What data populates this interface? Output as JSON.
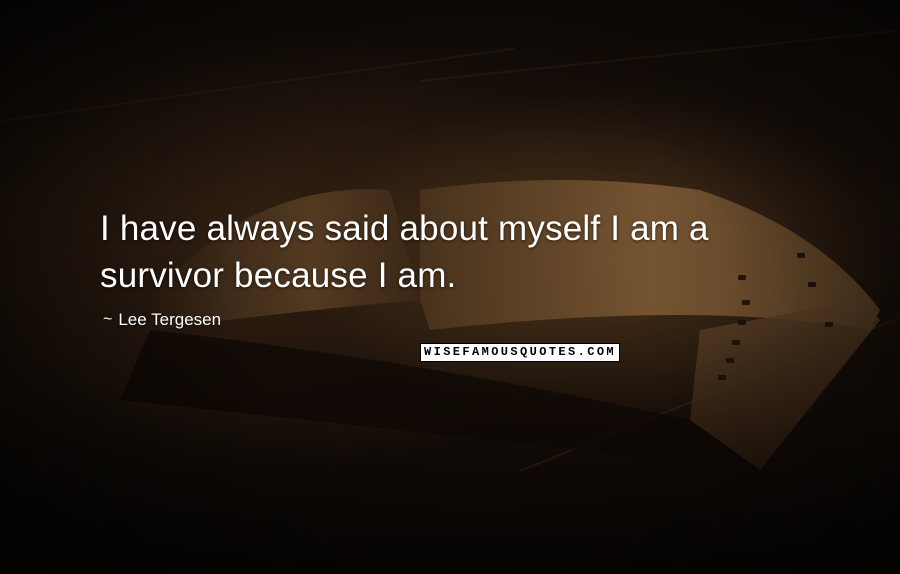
{
  "quote": {
    "text": "I have always said about myself I am a survivor because I am.",
    "author_prefix": "~",
    "author": "Lee Tergesen"
  },
  "watermark": {
    "text": "WISEFAMOUSQUOTES.COM"
  },
  "colors": {
    "text": "#ffffff",
    "background": "#140d08"
  }
}
